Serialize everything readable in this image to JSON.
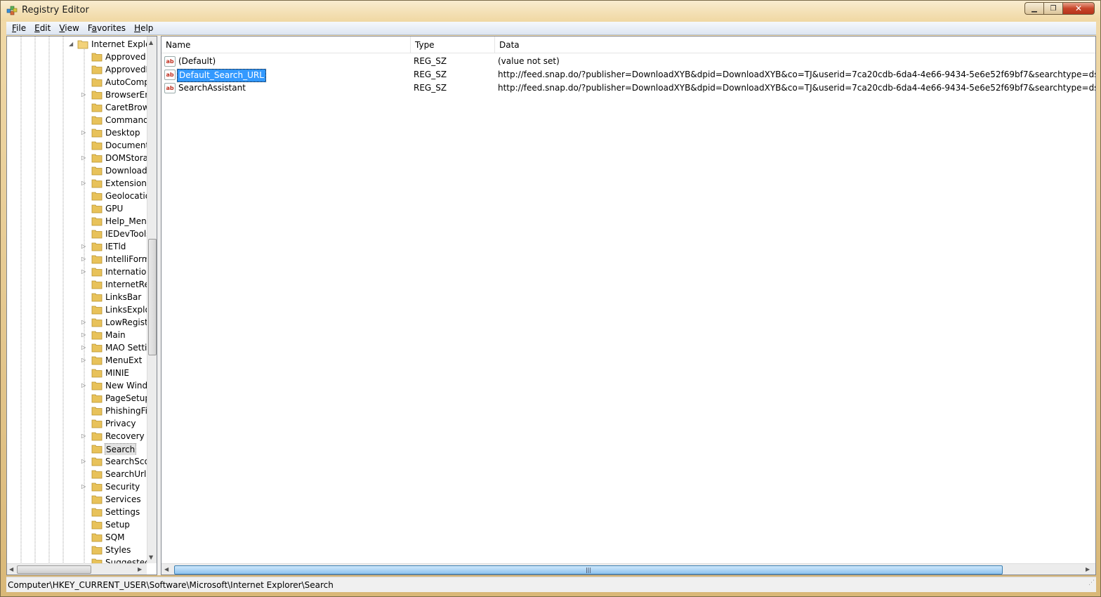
{
  "window": {
    "title": "Registry Editor"
  },
  "menu": [
    {
      "label": "File",
      "mnemonic": "F",
      "rest": "ile"
    },
    {
      "label": "Edit",
      "mnemonic": "E",
      "rest": "dit"
    },
    {
      "label": "View",
      "mnemonic": "V",
      "rest": "iew"
    },
    {
      "label": "Favorites",
      "mnemonic": "a",
      "pre": "F",
      "rest": "vorites"
    },
    {
      "label": "Help",
      "mnemonic": "H",
      "rest": "elp"
    }
  ],
  "tree": {
    "root": {
      "label": "Internet Explorer",
      "expanded": true
    },
    "items": [
      {
        "label": "Approved Extensions",
        "expandable": false
      },
      {
        "label": "ApprovedExtensionsMigration",
        "expandable": false
      },
      {
        "label": "AutoComplete",
        "expandable": false
      },
      {
        "label": "BrowserEmulation",
        "expandable": true
      },
      {
        "label": "CaretBrowsing",
        "expandable": false
      },
      {
        "label": "CommandBar",
        "expandable": false
      },
      {
        "label": "Desktop",
        "expandable": true
      },
      {
        "label": "DocumentWindows",
        "expandable": false
      },
      {
        "label": "DOMStorage",
        "expandable": true
      },
      {
        "label": "Download",
        "expandable": false
      },
      {
        "label": "Extensions",
        "expandable": true
      },
      {
        "label": "Geolocation",
        "expandable": false
      },
      {
        "label": "GPU",
        "expandable": false
      },
      {
        "label": "Help_Menu_URLs",
        "expandable": false
      },
      {
        "label": "IEDevTools",
        "expandable": false
      },
      {
        "label": "IETld",
        "expandable": true
      },
      {
        "label": "IntelliForms",
        "expandable": true
      },
      {
        "label": "International",
        "expandable": true
      },
      {
        "label": "InternetRegistry",
        "expandable": false
      },
      {
        "label": "LinksBar",
        "expandable": false
      },
      {
        "label": "LinksExplorer",
        "expandable": false
      },
      {
        "label": "LowRegistry",
        "expandable": true
      },
      {
        "label": "Main",
        "expandable": true
      },
      {
        "label": "MAO Settings",
        "expandable": true
      },
      {
        "label": "MenuExt",
        "expandable": true
      },
      {
        "label": "MINIE",
        "expandable": false
      },
      {
        "label": "New Windows",
        "expandable": true
      },
      {
        "label": "PageSetup",
        "expandable": false
      },
      {
        "label": "PhishingFilter",
        "expandable": false
      },
      {
        "label": "Privacy",
        "expandable": false
      },
      {
        "label": "Recovery",
        "expandable": true
      },
      {
        "label": "Search",
        "expandable": false,
        "selected": true
      },
      {
        "label": "SearchScopes",
        "expandable": true
      },
      {
        "label": "SearchUrl",
        "expandable": false
      },
      {
        "label": "Security",
        "expandable": true
      },
      {
        "label": "Services",
        "expandable": false
      },
      {
        "label": "Settings",
        "expandable": false
      },
      {
        "label": "Setup",
        "expandable": false
      },
      {
        "label": "SQM",
        "expandable": false
      },
      {
        "label": "Styles",
        "expandable": false
      },
      {
        "label": "Suggested Sites",
        "expandable": false
      }
    ]
  },
  "list": {
    "columns": [
      {
        "label": "Name"
      },
      {
        "label": "Type"
      },
      {
        "label": "Data"
      }
    ],
    "rows": [
      {
        "name": "(Default)",
        "type": "REG_SZ",
        "data": "(value not set)",
        "selected": false
      },
      {
        "name": "Default_Search_URL",
        "type": "REG_SZ",
        "data": "http://feed.snap.do/?publisher=DownloadXYB&dpid=DownloadXYB&co=TJ&userid=7ca20cdb-6da4-4e66-9434-5e6e52f69bf7&searchtype=ds&q={searchTerms}",
        "selected": true
      },
      {
        "name": "SearchAssistant",
        "type": "REG_SZ",
        "data": "http://feed.snap.do/?publisher=DownloadXYB&dpid=DownloadXYB&co=TJ&userid=7ca20cdb-6da4-4e66-9434-5e6e52f69bf7&searchtype=ds&q={searchTerms}",
        "selected": false
      }
    ],
    "value_icon": "string-value-icon",
    "value_icon_text": "ab"
  },
  "status": {
    "path": "Computer\\HKEY_CURRENT_USER\\Software\\Microsoft\\Internet Explorer\\Search"
  },
  "colors": {
    "selection": "#3399ff",
    "folder": "#e8c25a"
  }
}
